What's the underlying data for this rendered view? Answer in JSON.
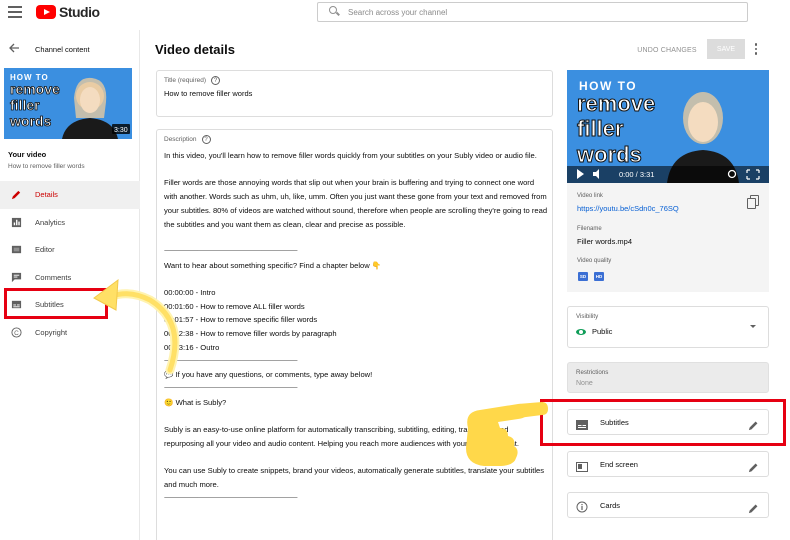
{
  "app": {
    "brand": "Studio",
    "brand_color": "#ff0000"
  },
  "search": {
    "placeholder": "Search across your channel"
  },
  "sidebar": {
    "back_label": "Channel content",
    "thumbnail_overlay": {
      "line1": "HOW TO",
      "line2": "remove",
      "line3": "filler",
      "line4": "words",
      "duration": "3:30"
    },
    "your_video_label": "Your video",
    "video_title": "How to remove filler words",
    "items": [
      {
        "label": "Details",
        "icon": "pencil-icon",
        "active": true
      },
      {
        "label": "Analytics",
        "icon": "analytics-icon",
        "active": false
      },
      {
        "label": "Editor",
        "icon": "editor-icon",
        "active": false
      },
      {
        "label": "Comments",
        "icon": "comments-icon",
        "active": false
      },
      {
        "label": "Subtitles",
        "icon": "subtitles-icon",
        "active": false
      },
      {
        "label": "Copyright",
        "icon": "copyright-icon",
        "active": false
      }
    ]
  },
  "header": {
    "title": "Video details",
    "undo_label": "UNDO CHANGES",
    "save_label": "SAVE"
  },
  "title_field": {
    "label": "Title (required)",
    "value": "How to remove filler words"
  },
  "description_field": {
    "label": "Description",
    "lines": [
      "In this video, you'll learn how to remove filler words quickly from your subtitles on your Subly video or audio file.",
      "",
      "Filler words are those annoying words that slip out when your brain is buffering and trying to connect one word with another.  Words such as uhm, uh, like, umm.  Often you just want these gone from your text and removed from your subtitles.  80% of videos are watched without sound, therefore when people are scrolling they're going to read the subtitles and you want them as clean, clear and precise as possible.",
      "",
      "-------------------------------------------------------------------------------------------------------------------------------------",
      "Want to hear about something specific? Find a chapter below 👇",
      "",
      "00:00:00 - Intro",
      "00:01:60 - How to remove ALL filler words",
      "00:01:57 - How to remove specific filler words",
      "00:02:38 - How to remove filler words by paragraph",
      "00:03:16 - Outro",
      "-------------------------------------------------------------------------------------------------------------------------------------",
      "💬 If you have any questions, or comments, type away below!",
      "-------------------------------------------------------------------------------------------------------------------------------------",
      "🙂 What is Subly?",
      "",
      "Subly is an easy-to-use online platform for automatically transcribing, subtitling, editing, translating and repurposing all your video and audio content.  Helping you reach more audiences with your online content.",
      "",
      "You can use Subly to create snippets, brand your videos, automatically generate subtitles, translate your subtitles and much more.",
      "-------------------------------------------------------------------------------------------------------------------------------------"
    ]
  },
  "preview": {
    "thumbnail_overlay": {
      "line1": "HOW TO",
      "line2": "remove",
      "line3": "filler",
      "line4": "words"
    },
    "time": "0:00 / 3:31",
    "video_link_label": "Video link",
    "video_link": "https://youtu.be/cSdn0c_76SQ",
    "filename_label": "Filename",
    "filename": "Filler words.mp4",
    "quality_label": "Video quality",
    "quality_badges": [
      "SD",
      "HD"
    ]
  },
  "visibility": {
    "label": "Visibility",
    "value": "Public"
  },
  "restrictions": {
    "label": "Restrictions",
    "value": "None"
  },
  "rows": {
    "subtitles": "Subtitles",
    "end_screen": "End screen",
    "cards": "Cards"
  },
  "annotation_colors": {
    "highlight": "#e60012",
    "arrow": "#ffe066",
    "hand": "#ffd84a"
  }
}
